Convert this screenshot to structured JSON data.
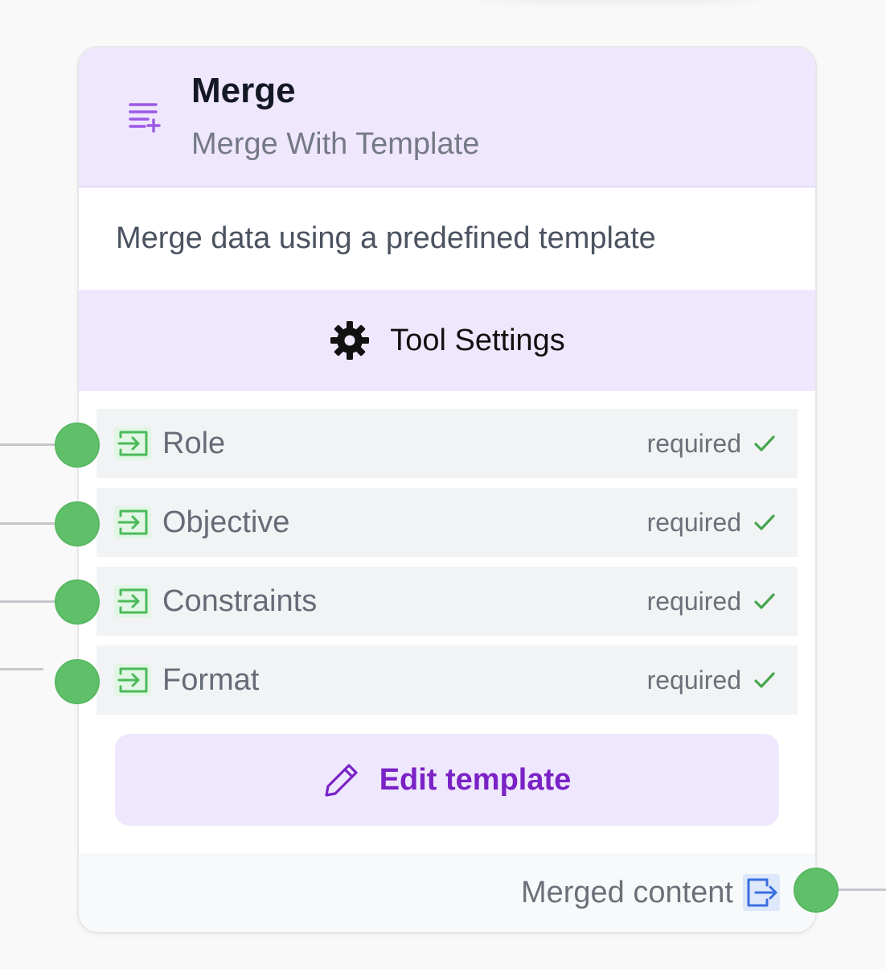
{
  "node": {
    "title": "Merge",
    "subtitle": "Merge With Template",
    "description": "Merge data using a predefined template",
    "header_icon": "list-plus-icon"
  },
  "settings": {
    "label": "Tool Settings",
    "icon": "gear-icon"
  },
  "inputs": [
    {
      "label": "Role",
      "status": "required",
      "icon": "input-arrow-icon"
    },
    {
      "label": "Objective",
      "status": "required",
      "icon": "input-arrow-icon"
    },
    {
      "label": "Constraints",
      "status": "required",
      "icon": "input-arrow-icon"
    },
    {
      "label": "Format",
      "status": "required",
      "icon": "input-arrow-icon"
    }
  ],
  "edit_button": {
    "label": "Edit template",
    "icon": "pencil-icon"
  },
  "output": {
    "label": "Merged content",
    "icon": "output-arrow-icon"
  },
  "colors": {
    "accent_purple": "#7a22c6",
    "header_bg": "#efe7fe",
    "handle_green": "#5fc069",
    "check_green": "#45a650",
    "output_blue": "#3b6fe0"
  }
}
